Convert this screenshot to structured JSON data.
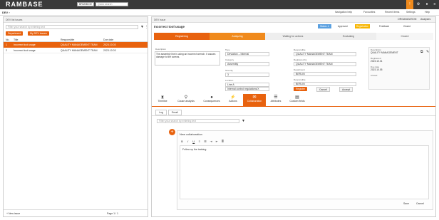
{
  "app": {
    "logo": "RAMBASE",
    "company_select": "BRUNB.DE",
    "search_placeholder": "Quick search"
  },
  "topbar_icons": [
    "bell-icon",
    "settings-icon",
    "user-icon"
  ],
  "subbar": {
    "breadcrumb": "DEV ›",
    "links": [
      "Navigation help",
      "Favourites",
      "Recent items",
      "Settings",
      "Help"
    ]
  },
  "left": {
    "title": "DEV list issues",
    "search_placeholder": "Filter your search by entering text",
    "buttons": [
      "Department",
      "My DEV issues"
    ],
    "columns": [
      "No.",
      "Title",
      "Responsible",
      "Due date"
    ],
    "rows": [
      {
        "no": "1",
        "title": "Incorrect tool usage",
        "resp": "QUALITY MANAGEMENT TEAM",
        "date": "2023.10.03",
        "selected": true
      },
      {
        "no": "2",
        "title": "Incorrect tool usage",
        "resp": "QUALITY MANAGEMENT TEAM",
        "date": "2023.10.03",
        "selected": false
      }
    ],
    "footer": {
      "add": "+ New issue",
      "page": "Page 1 / 1"
    }
  },
  "right": {
    "header": "DEV issue",
    "title": "Incorrect tool usage",
    "status": "Status: 4",
    "badges": [
      "Approved",
      "Registration",
      "Feedback",
      "Closed"
    ],
    "right_links": [
      "ORGANIZATION",
      "Analyses"
    ],
    "steps": [
      "Registering",
      "Analyzing",
      "Waiting for actions",
      "Evaluating",
      "Closed"
    ],
    "description_label": "Description",
    "description": "The assembly line is using an incorrect wrench. It causes damage to the screws.",
    "fields_left": [
      {
        "label": "Type",
        "value": "Deviation – Internal"
      },
      {
        "label": "Category",
        "value": "Assembly"
      },
      {
        "label": "Severity",
        "value": "3"
      },
      {
        "label": "Location",
        "value": "Line A"
      },
      {
        "label": "Responsible",
        "value": "Internal control regulations/X"
      }
    ],
    "fields_mid": [
      {
        "label": "Responsible",
        "value": "QUALITY MANAGEMENT TEAM"
      },
      {
        "label": "Registered by",
        "value": "QUALITY MANAGEMENT TEAM"
      },
      {
        "label": "Department",
        "value": "BERLIN"
      },
      {
        "label": "Responsible",
        "value": "BERLIN"
      }
    ],
    "mid_buttons": [
      "Register",
      "Cancel",
      "Accept"
    ],
    "info_box": [
      {
        "label": "Description",
        "value": "QUALITY MANAGEMENT"
      },
      {
        "label": "Registered",
        "value": "2023.10.01"
      },
      {
        "label": "Due date",
        "value": "2023.10.05"
      },
      {
        "label": "Closed",
        "value": ""
      }
    ],
    "tabs": [
      "Timeline",
      "Cause analysis",
      "Consequences",
      "Actions",
      "Collaboration",
      "Attributes",
      "Custom fields"
    ],
    "active_tab": "Collaboration",
    "subtabs": [
      "Log",
      "Email"
    ],
    "filter_placeholder": "Filter your search by entering text",
    "note_title": "New collaboration",
    "note_text": "Follow up the training.",
    "note_buttons": [
      "Save",
      "Cancel"
    ]
  },
  "colors": {
    "accent": "#e8620e",
    "topbar": "#3a3a3a"
  }
}
